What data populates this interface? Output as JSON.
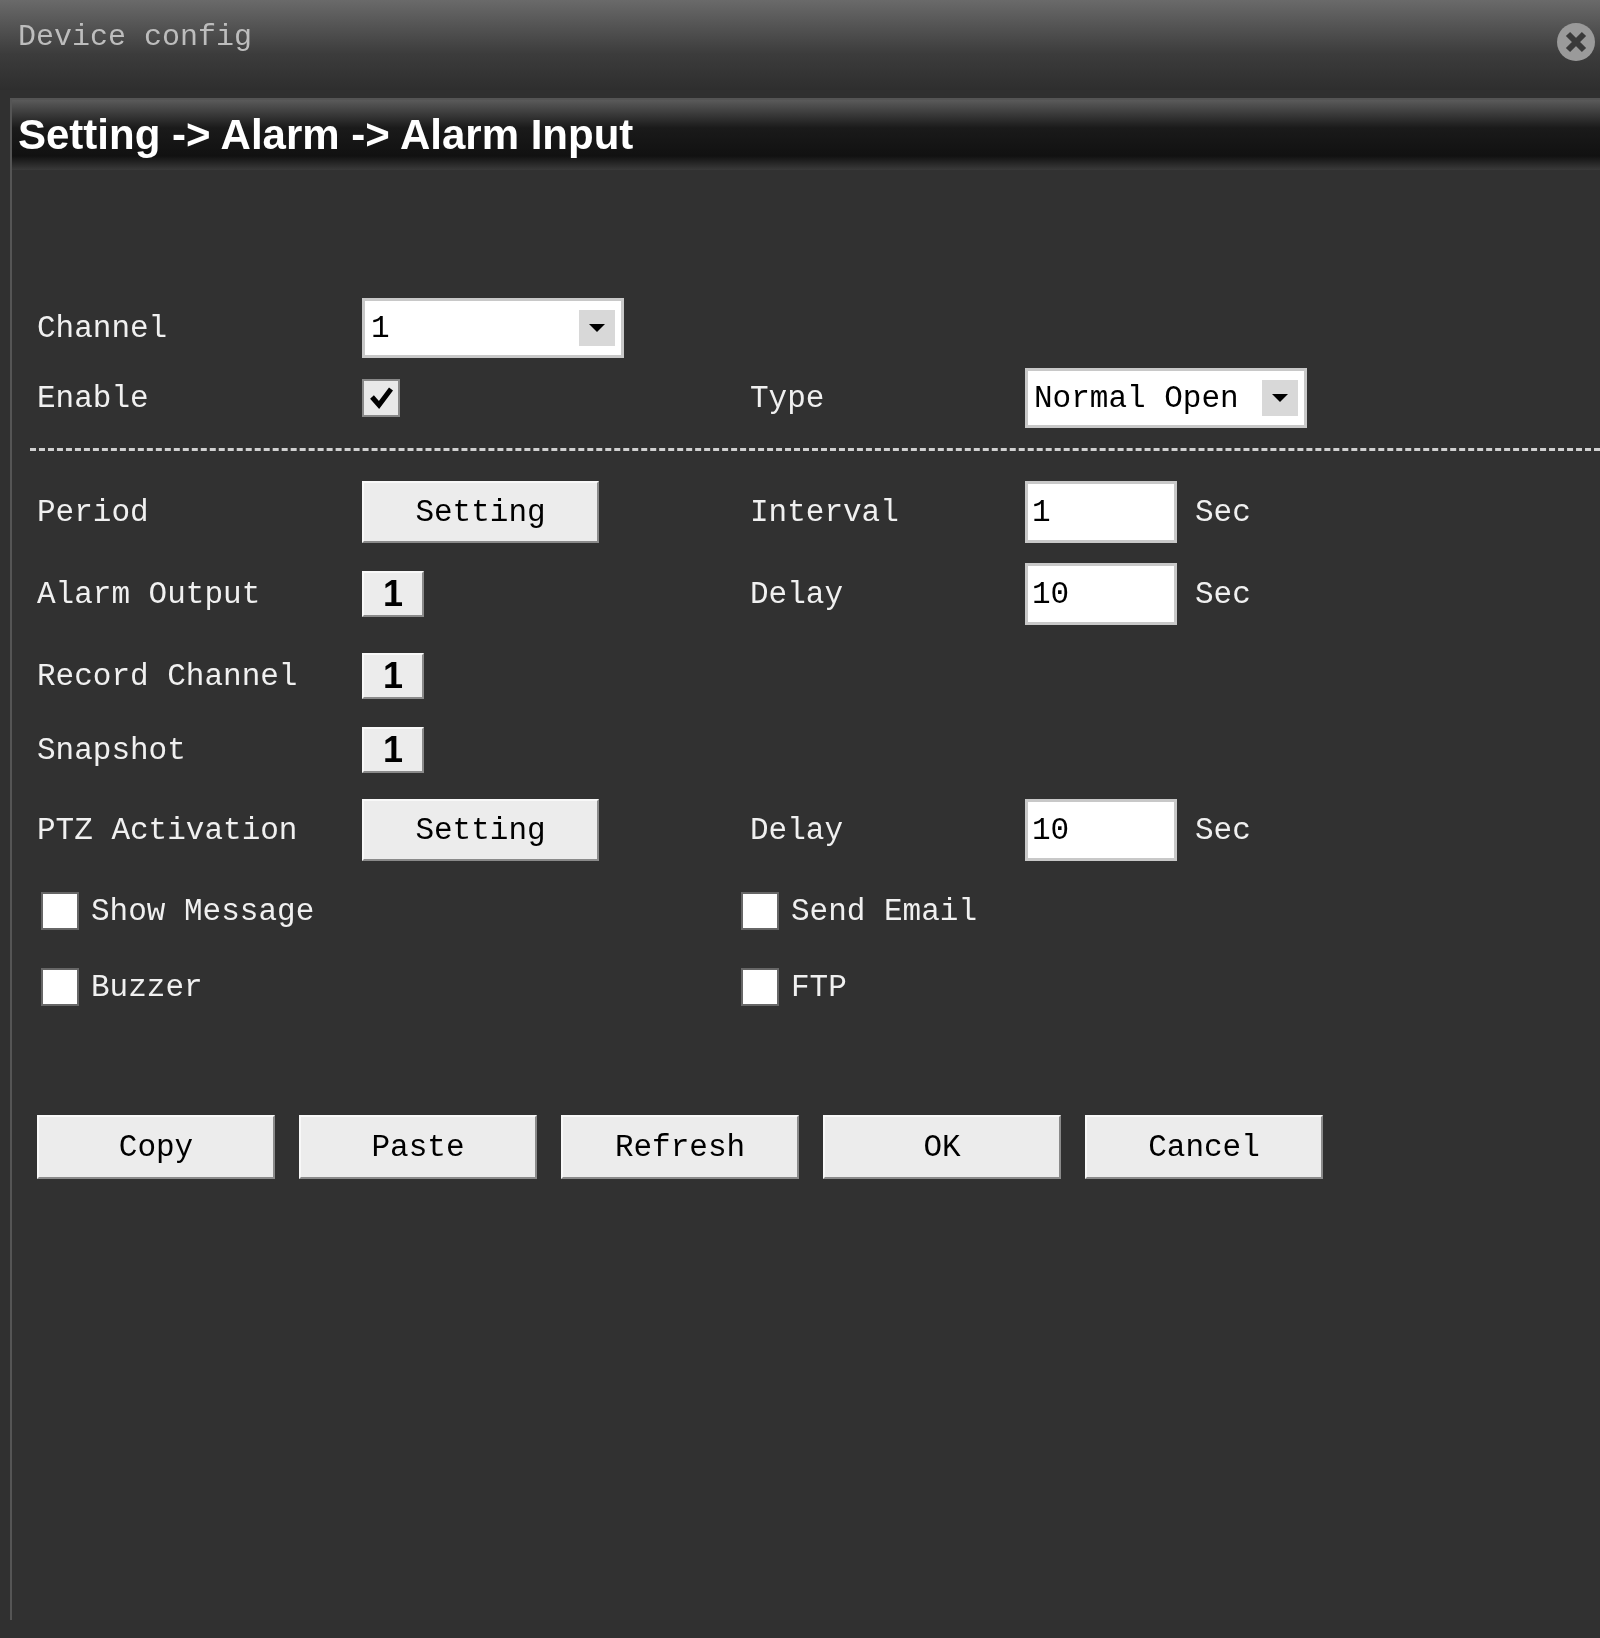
{
  "window": {
    "title": "Device config"
  },
  "breadcrumb": "Setting -> Alarm -> Alarm Input",
  "channel": {
    "label": "Channel",
    "value": "1"
  },
  "enable": {
    "label": "Enable",
    "checked": true
  },
  "type": {
    "label": "Type",
    "value": "Normal Open"
  },
  "rows": [
    {
      "label": "Period",
      "kind": "button",
      "value": "Setting",
      "right": {
        "label": "Interval",
        "value": "1",
        "unit": "Sec"
      }
    },
    {
      "label": "Alarm Output",
      "kind": "box",
      "value": "1",
      "right": {
        "label": "Delay",
        "value": "10",
        "unit": "Sec"
      }
    },
    {
      "label": "Record Channel",
      "kind": "box",
      "value": "1"
    },
    {
      "label": "Snapshot",
      "kind": "box",
      "value": "1"
    },
    {
      "label": "PTZ Activation",
      "kind": "button",
      "value": "Setting",
      "right": {
        "label": "Delay",
        "value": "10",
        "unit": "Sec"
      }
    }
  ],
  "checks": [
    {
      "label": "Show Message",
      "checked": false
    },
    {
      "label": "Send Email",
      "checked": false
    },
    {
      "label": "Buzzer",
      "checked": false
    },
    {
      "label": "FTP",
      "checked": false
    }
  ],
  "buttons": [
    "Copy",
    "Paste",
    "Refresh",
    "OK",
    "Cancel"
  ]
}
